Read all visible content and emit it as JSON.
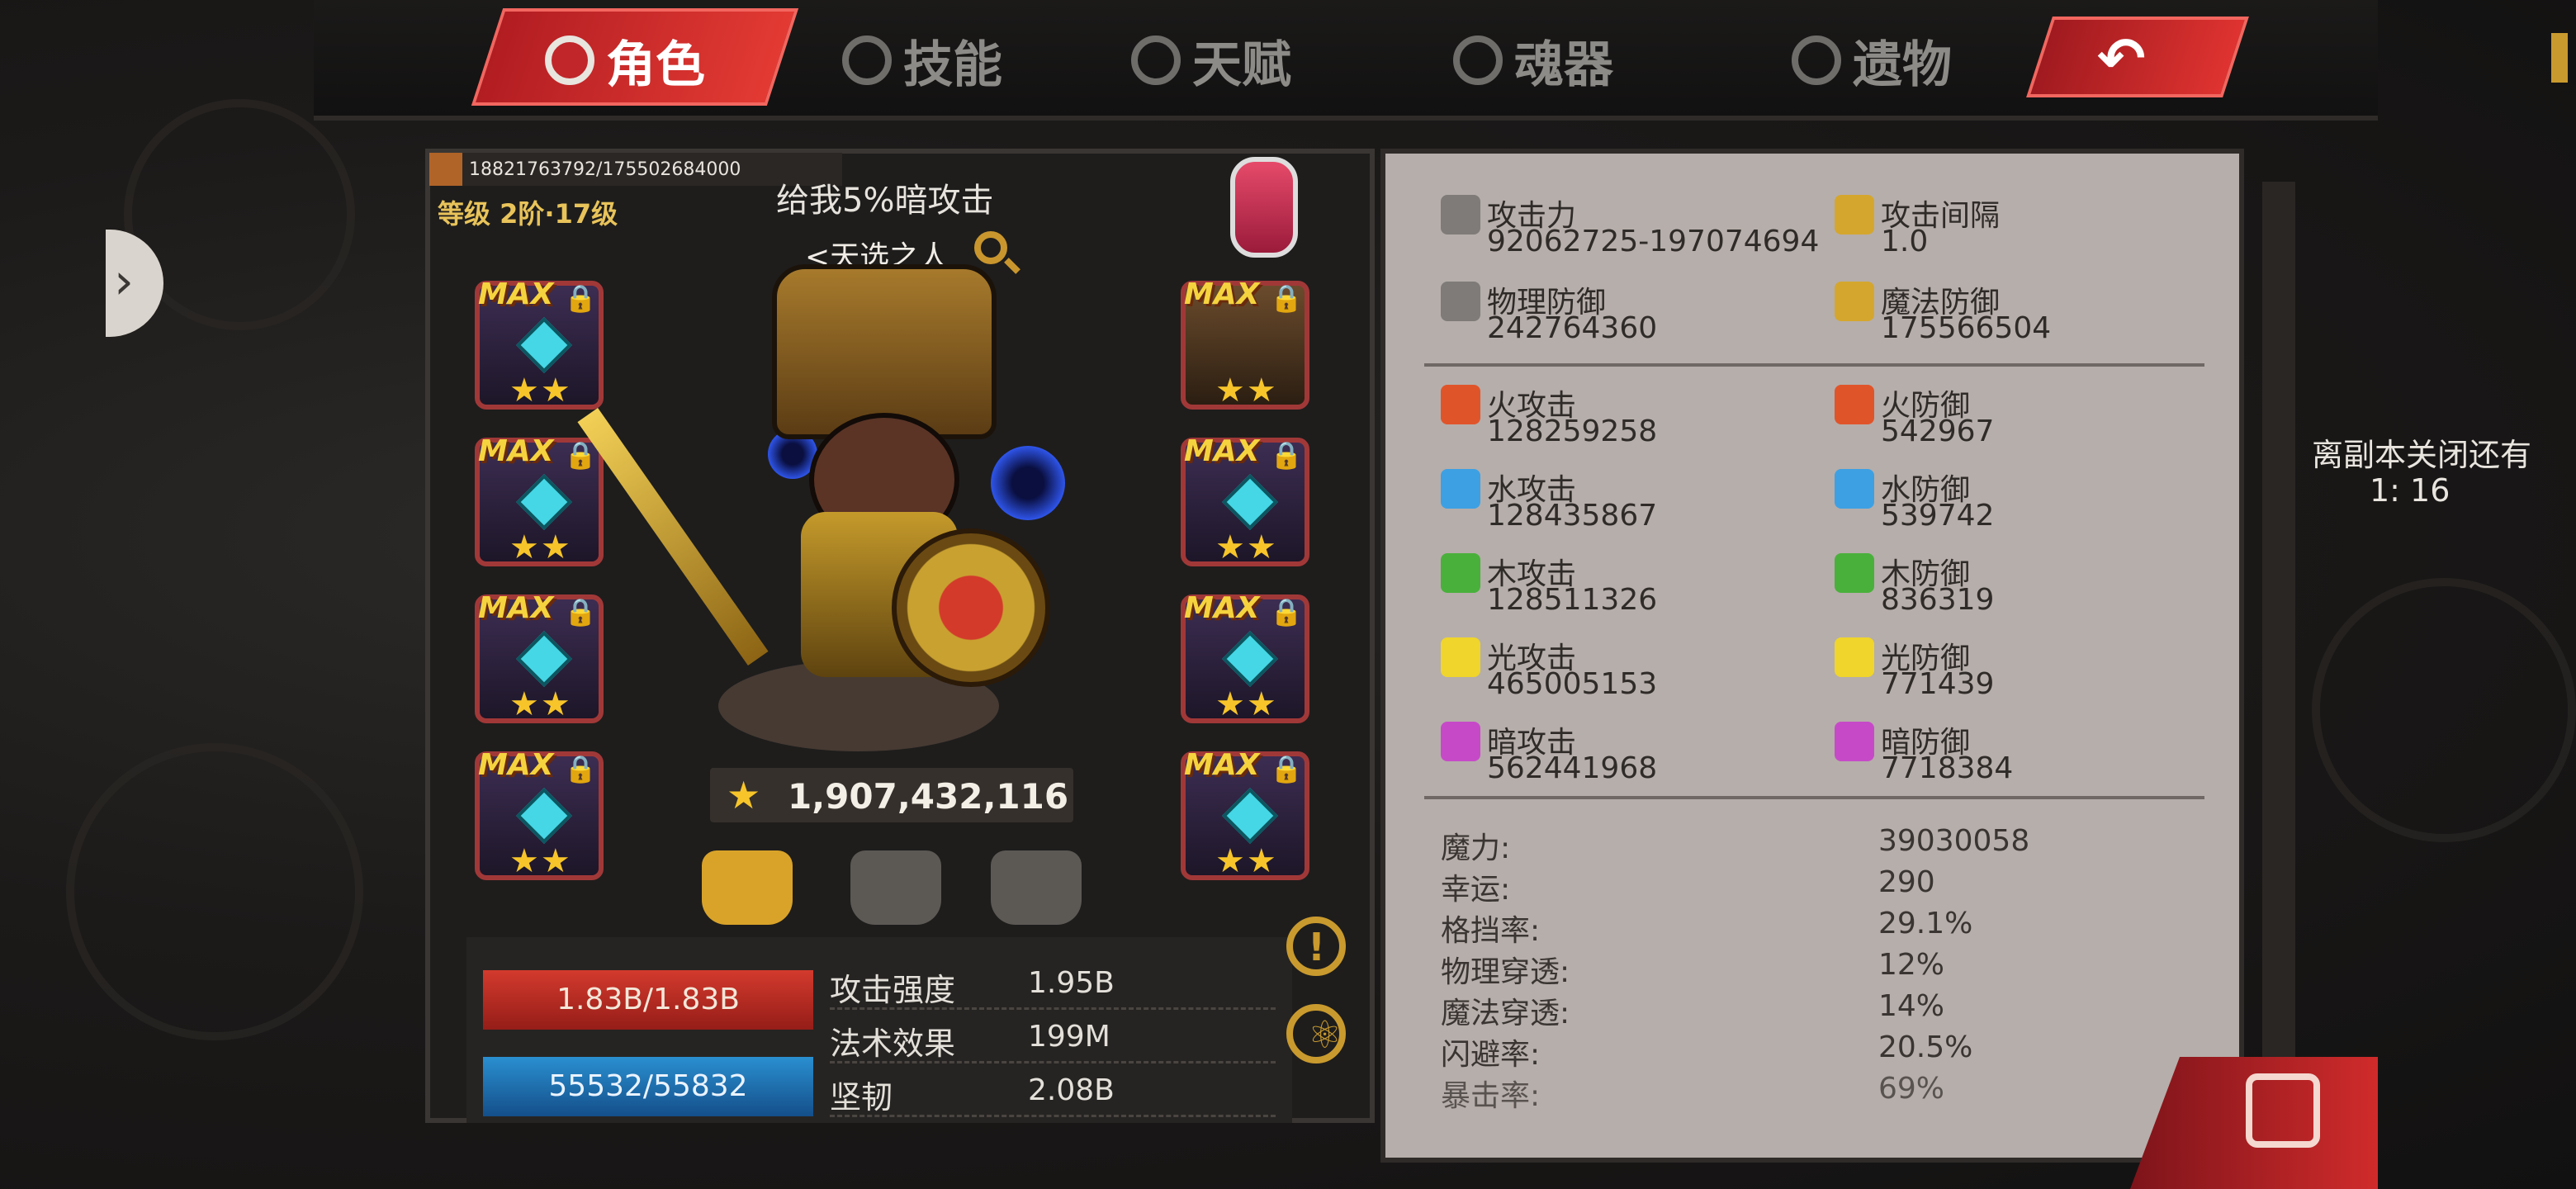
{
  "tabs": [
    {
      "label": "角色",
      "icon": "character-icon",
      "active": true
    },
    {
      "label": "技能",
      "icon": "skill-icon",
      "active": false
    },
    {
      "label": "天赋",
      "icon": "talent-icon",
      "active": false
    },
    {
      "label": "魂器",
      "icon": "soul-vessel-icon",
      "active": false
    },
    {
      "label": "遗物",
      "icon": "relic-icon",
      "active": false
    }
  ],
  "back_icon": "back-arrow-icon",
  "player": {
    "id_text": "18821763792/175502684000",
    "level": "等级 2阶·17级",
    "quote": "给我5%暗攻击",
    "title": "<天选之人"
  },
  "equipment": {
    "max_label": "MAX",
    "stars": "★★",
    "lock": "🔒"
  },
  "power": {
    "star": "★",
    "value": "1,907,432,116"
  },
  "bars": {
    "hp": "1.83B/1.83B",
    "mp": "55532/55832"
  },
  "summary": [
    {
      "label": "攻击强度",
      "value": "1.95B"
    },
    {
      "label": "法术效果",
      "value": "199M"
    },
    {
      "label": "坚韧",
      "value": "2.08B"
    }
  ],
  "stats_main": [
    {
      "label": "攻击力",
      "value": "92062725-197074694",
      "icon": "sword-icon",
      "color": "#7e7b78"
    },
    {
      "label": "攻击间隔",
      "value": "1.0",
      "icon": "golden-sword-icon",
      "color": "#d4a62d"
    },
    {
      "label": "物理防御",
      "value": "242764360",
      "icon": "shield-sword-icon",
      "color": "#7e7b78"
    },
    {
      "label": "魔法防御",
      "value": "175566504",
      "icon": "magic-shield-icon",
      "color": "#d4a62d"
    }
  ],
  "stats_element": [
    {
      "atk_label": "火攻击",
      "atk_value": "128259258",
      "def_label": "火防御",
      "def_value": "542967",
      "color": "#e0542a"
    },
    {
      "atk_label": "水攻击",
      "atk_value": "128435867",
      "def_label": "水防御",
      "def_value": "539742",
      "color": "#3da0e3"
    },
    {
      "atk_label": "木攻击",
      "atk_value": "128511326",
      "def_label": "木防御",
      "def_value": "836319",
      "color": "#49b03c"
    },
    {
      "atk_label": "光攻击",
      "atk_value": "465005153",
      "def_label": "光防御",
      "def_value": "771439",
      "color": "#efd52c"
    },
    {
      "atk_label": "暗攻击",
      "atk_value": "562441968",
      "def_label": "暗防御",
      "def_value": "7718384",
      "color": "#c64ac8"
    }
  ],
  "stats_misc": [
    {
      "label": "魔力:",
      "value": "39030058"
    },
    {
      "label": "幸运:",
      "value": "290"
    },
    {
      "label": "格挡率:",
      "value": "29.1%"
    },
    {
      "label": "物理穿透:",
      "value": "12%"
    },
    {
      "label": "魔法穿透:",
      "value": "14%"
    },
    {
      "label": "闪避率:",
      "value": "20.5%"
    },
    {
      "label": "暴击率:",
      "value": "69%"
    }
  ],
  "countdown": {
    "label": "离副本关闭还有",
    "time": "1: 16"
  }
}
